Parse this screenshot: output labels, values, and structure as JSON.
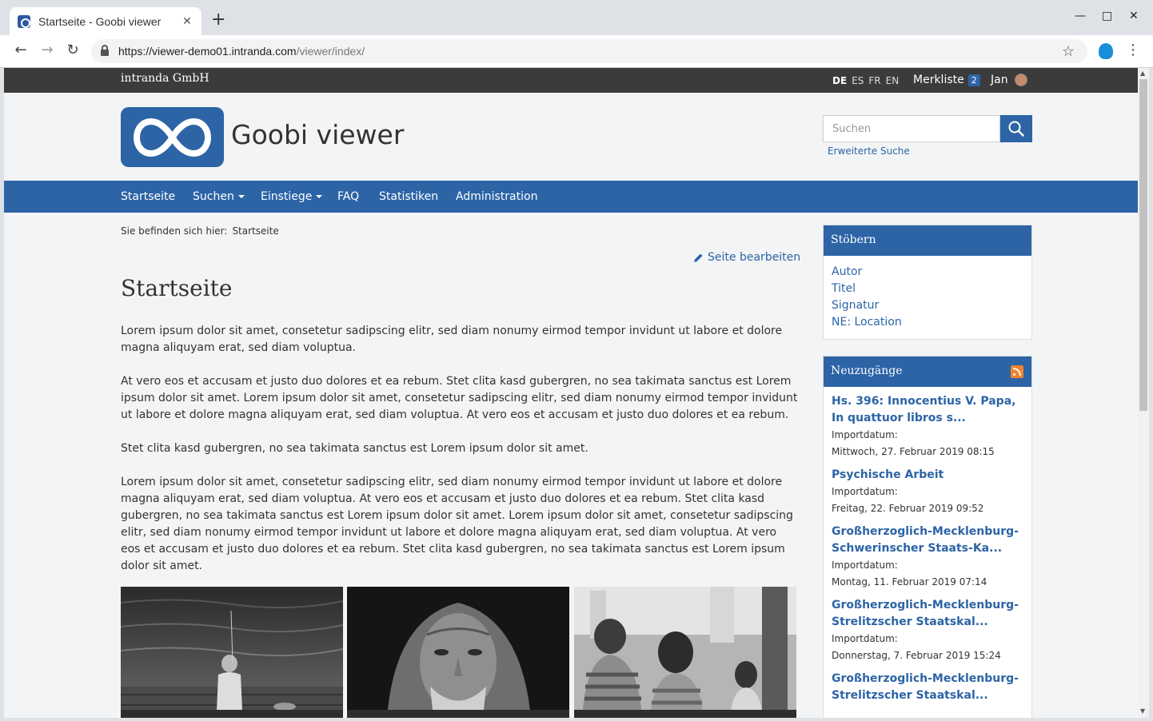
{
  "browser": {
    "tab_title": "Startseite - Goobi viewer",
    "url_host": "https://viewer-demo01.intranda.com",
    "url_path": "/viewer/index/"
  },
  "topbar": {
    "company": "intranda GmbH",
    "languages": [
      "DE",
      "ES",
      "FR",
      "EN"
    ],
    "active_language": "DE",
    "merkliste_label": "Merkliste",
    "merkliste_count": "2",
    "user_name": "Jan"
  },
  "header": {
    "site_title": "Goobi viewer",
    "search_placeholder": "Suchen",
    "advanced_search": "Erweiterte Suche"
  },
  "nav": {
    "items": [
      {
        "label": "Startseite",
        "dropdown": false
      },
      {
        "label": "Suchen",
        "dropdown": true
      },
      {
        "label": "Einstiege",
        "dropdown": true
      },
      {
        "label": "FAQ",
        "dropdown": false
      },
      {
        "label": "Statistiken",
        "dropdown": false
      },
      {
        "label": "Administration",
        "dropdown": false
      }
    ]
  },
  "main": {
    "breadcrumb_prefix": "Sie befinden sich hier:",
    "breadcrumb_current": "Startseite",
    "edit_label": "Seite bearbeiten",
    "heading": "Startseite",
    "paragraphs": [
      "Lorem ipsum dolor sit amet, consetetur sadipscing elitr, sed diam nonumy eirmod tempor invidunt ut labore et dolore magna aliquyam erat, sed diam voluptua.",
      "At vero eos et accusam et justo duo dolores et ea rebum. Stet clita kasd gubergren, no sea takimata sanctus est Lorem ipsum dolor sit amet. Lorem ipsum dolor sit amet, consetetur sadipscing elitr, sed diam nonumy eirmod tempor invidunt ut labore et dolore magna aliquyam erat, sed diam voluptua. At vero eos et accusam et justo duo dolores et ea rebum.",
      "Stet clita kasd gubergren, no sea takimata sanctus est Lorem ipsum dolor sit amet.",
      "Lorem ipsum dolor sit amet, consetetur sadipscing elitr, sed diam nonumy eirmod tempor invidunt ut labore et dolore magna aliquyam erat, sed diam voluptua. At vero eos et accusam et justo duo dolores et ea rebum. Stet clita kasd gubergren, no sea takimata sanctus est Lorem ipsum dolor sit amet. Lorem ipsum dolor sit amet, consetetur sadipscing elitr, sed diam nonumy eirmod tempor invidunt ut labore et dolore magna aliquyam erat, sed diam voluptua. At vero eos et accusam et justo duo dolores et ea rebum. Stet clita kasd gubergren, no sea takimata sanctus est Lorem ipsum dolor sit amet."
    ]
  },
  "sidebar": {
    "browse": {
      "title": "Stöbern",
      "links": [
        "Autor",
        "Titel",
        "Signatur",
        "NE: Location"
      ]
    },
    "new_items": {
      "title": "Neuzugänge",
      "entries": [
        {
          "title": "Hs. 396: Innocentius V. Papa, In quattuor libros s...",
          "label": "Importdatum:",
          "date": "Mittwoch, 27. Februar 2019 08:15"
        },
        {
          "title": "Psychische Arbeit",
          "label": "Importdatum:",
          "date": "Freitag, 22. Februar 2019 09:52"
        },
        {
          "title": "Großherzoglich-Mecklenburg-Schwerinscher Staats-Ka...",
          "label": "Importdatum:",
          "date": "Montag, 11. Februar 2019 07:14"
        },
        {
          "title": "Großherzoglich-Mecklenburg-Strelitzscher Staatskal...",
          "label": "Importdatum:",
          "date": "Donnerstag, 7. Februar 2019 15:24"
        },
        {
          "title": "Großherzoglich-Mecklenburg-Strelitzscher Staatskal...",
          "label": "",
          "date": ""
        }
      ]
    }
  },
  "colors": {
    "brand_blue": "#2c64a6",
    "topbar": "#3b3b3b",
    "page_bg": "#f3f4f5"
  }
}
